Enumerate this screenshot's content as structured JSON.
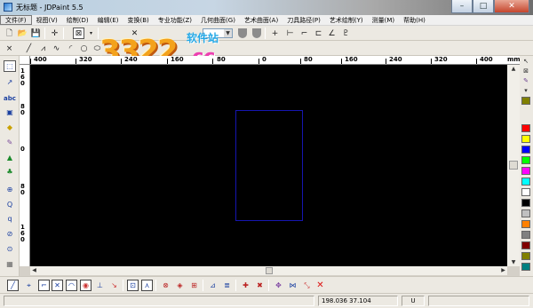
{
  "window": {
    "title": "无标题 - JDPaint 5.5",
    "minimize_label": "–",
    "maximize_label": "□",
    "close_label": "✕"
  },
  "menu": [
    "文件(F)",
    "视图(V)",
    "绘制(D)",
    "编辑(E)",
    "变换(B)",
    "专业功能(Z)",
    "几何曲面(G)",
    "艺术曲面(A)",
    "刀具路径(P)",
    "艺术绘制(Y)",
    "测量(M)",
    "帮助(H)"
  ],
  "ruler": {
    "h_labels": [
      "400",
      "320",
      "240",
      "160",
      "80",
      "0",
      "80",
      "160",
      "240",
      "320",
      "400"
    ],
    "v_labels": [
      "160",
      "80",
      "0",
      "80",
      "160"
    ],
    "unit": "mm"
  },
  "watermark": {
    "brand": "3322",
    "suffix": ".cc",
    "site": "软件站"
  },
  "status": {
    "coords": "198.036 37.104",
    "mode": "U"
  },
  "palette": {
    "colors": [
      "#ff0000",
      "#ffff00",
      "#0000ff",
      "#00ff00",
      "#ff00ff",
      "#00ffff",
      "#ffffff",
      "#000000",
      "#c0c0c0",
      "#ff8000",
      "#808080",
      "#800000",
      "#808000",
      "#008000",
      "#800080",
      "#008080"
    ]
  }
}
